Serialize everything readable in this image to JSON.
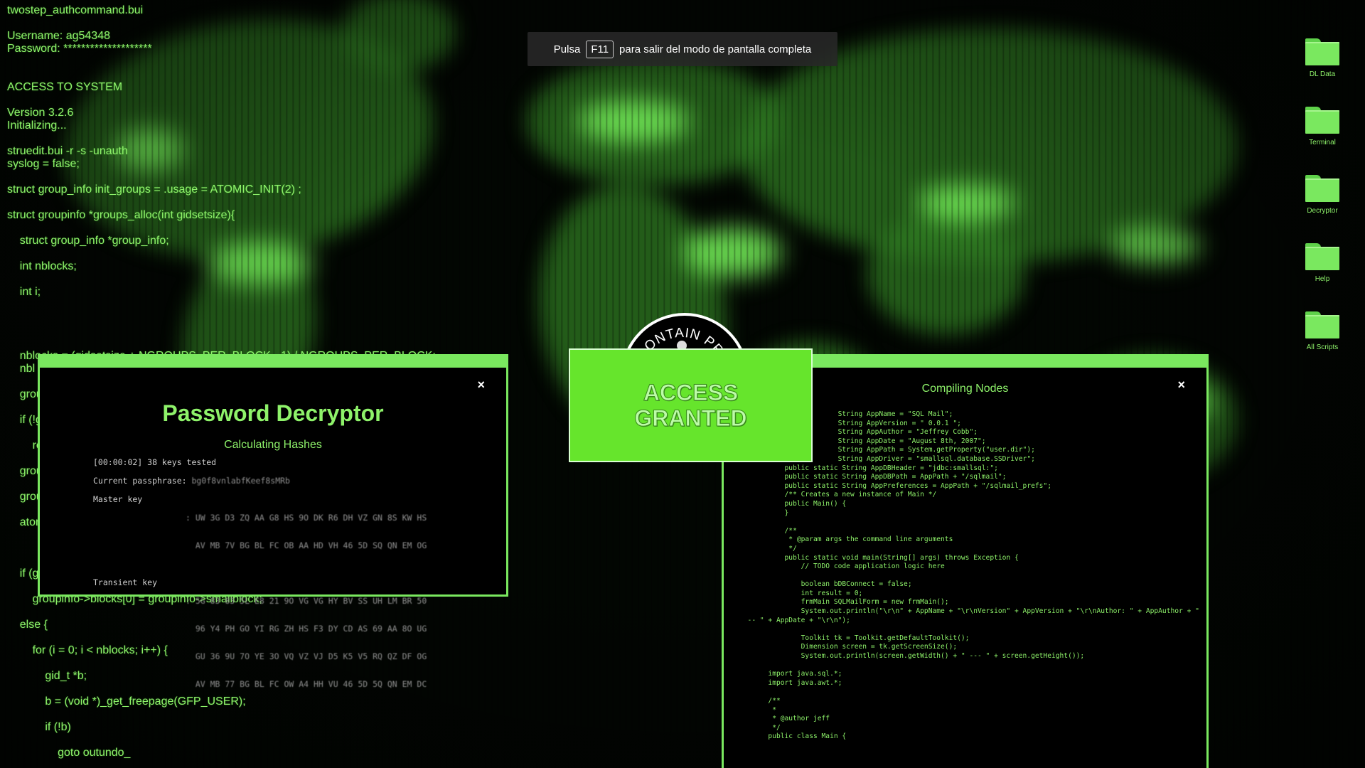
{
  "terminal": {
    "lines": [
      "twostep_authcommand.bui",
      "",
      "Username: ag54348",
      "Password: ********************",
      "",
      "",
      "ACCESS TO SYSTEM",
      "",
      "Version 3.2.6",
      "Initializing...",
      "",
      "struedit.bui -r -s -unauth",
      "syslog = false;",
      "",
      "struct group_info init_groups = .usage = ATOMIC_INIT(2) ;",
      "",
      "struct groupinfo *groups_alloc(int gidsetsize){",
      "",
      "    struct group_info *group_info;",
      "",
      "    int nblocks;",
      "",
      "    int i;",
      "",
      "",
      "",
      "",
      "    nblocks = (gidsetsize + NGROUPS_PER_BLOCK - 1) / NGROUPS_PER_BLOCK;",
      "    nbl",
      "",
      "    grou",
      "",
      "    if (!g",
      "",
      "        re",
      "",
      "    grou",
      "",
      "    grou",
      "",
      "    atom",
      "",
      "",
      "",
      "    if (g",
      "",
      "        groupinfo->blocks[0] = groupinfo->smallblock;",
      "",
      "    else {",
      "",
      "        for (i = 0; i < nblocks; i++) {",
      "",
      "            gid_t *b;",
      "",
      "            b = (void *)_get_freepage(GFP_USER);",
      "",
      "            if (!b)",
      "",
      "                goto outundo_"
    ]
  },
  "fullscreen_notice": {
    "pre": "Pulsa",
    "key": "F11",
    "post": "para salir del modo de pantalla completa"
  },
  "desktop_icons": [
    {
      "label": "DL Data",
      "icon": "folder-icon"
    },
    {
      "label": "Terminal",
      "icon": "folder-icon"
    },
    {
      "label": "Decryptor",
      "icon": "folder-icon"
    },
    {
      "label": "Help",
      "icon": "folder-icon"
    },
    {
      "label": "All Scripts",
      "icon": "folder-icon"
    }
  ],
  "emblem": {
    "text": "E CONTAIN PR"
  },
  "password_window": {
    "title": "Password Decryptor",
    "subtitle": "Calculating Hashes",
    "close": "×",
    "status": "[00:00:02] 38 keys tested",
    "passphrase_label": "Current passphrase:",
    "passphrase_value": "bg0f8vnlabfKeef8sMRb",
    "master_key_label": "Master key",
    "master_key_rows": [
      ": UW 3G D3 ZQ AA G8 HS 9O DK R6 DH VZ GN 8S KW HS",
      "  AV MB 7V BG BL FC OB AA HD VH 46 5D SQ QN EM OG"
    ],
    "transient_key_label": "Transient key",
    "transient_key_rows": [
      ": 5G 83 83 5L E8 21 9O VG VG HY BV SS UH LM BR 50",
      "  96 Y4 PH GO YI RG ZH HS F3 DY CD AS 69 AA 8O UG",
      "  GU 36 9U 7O YE 3O VQ VZ VJ D5 K5 V5 RQ QZ DF OG",
      "  AV MB 77 BG BL FC OW A4 HH VU 46 5D 5Q QN EM DC"
    ]
  },
  "access": {
    "line1": "ACCESS",
    "line2": "GRANTED"
  },
  "compile_window": {
    "title": "Compiling Nodes",
    "close": "×",
    "code_lines": [
      "                        String AppName = \"SQL Mail\";",
      "                        String AppVersion = \" 0.0.1 \";",
      "                        String AppAuthor = \"Jeffrey Cobb\";",
      "                        String AppDate = \"August 8th, 2007\";",
      "                        String AppPath = System.getProperty(\"user.dir\");",
      "                        String AppDriver = \"smallsql.database.SSDriver\";",
      "           public static String AppDBHeader = \"jdbc:smallsql:\";",
      "           public static String AppDBPath = AppPath + \"/sqlmail\";",
      "           public static String AppPreferences = AppPath + \"/sqlmail_prefs\";",
      "           /** Creates a new instance of Main */",
      "           public Main() {",
      "           }",
      "",
      "           /**",
      "            * @param args the command line arguments",
      "            */",
      "           public static void main(String[] args) throws Exception {",
      "               // TODO code application logic here",
      "",
      "               boolean bDBConnect = false;",
      "               int result = 0;",
      "               frmMain SQLMailForm = new frmMain();",
      "               System.out.println(\"\\r\\n\" + AppName + \"\\r\\nVersion\" + AppVersion + \"\\r\\nAuthor: \" + AppAuthor + \"",
      "  -- \" + AppDate + \"\\r\\n\");",
      "",
      "               Toolkit tk = Toolkit.getDefaultToolkit();",
      "               Dimension screen = tk.getScreenSize();",
      "               System.out.println(screen.getWidth() + \" --- \" + screen.getHeight());",
      "",
      "       import java.sql.*;",
      "       import java.awt.*;",
      "",
      "       /**",
      "        *",
      "        * @author jeff",
      "        */",
      "       public class Main {"
    ]
  },
  "colors": {
    "accent_green": "#7ae85f",
    "text_green": "#8ef26a",
    "access_green": "#66e52c",
    "background": "#020602"
  }
}
